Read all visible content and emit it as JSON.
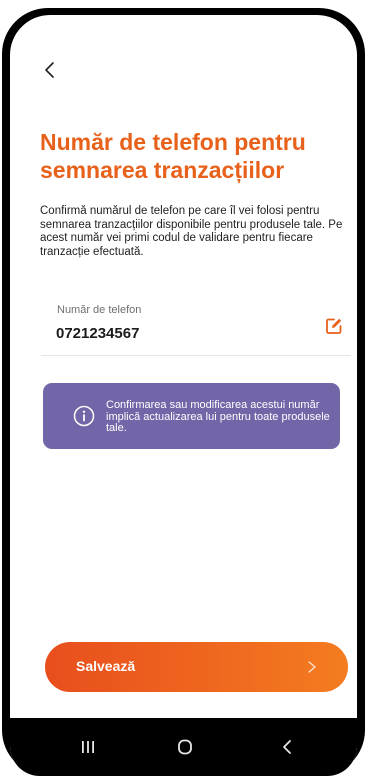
{
  "header": {
    "back_icon": "chevron-left-icon"
  },
  "page": {
    "title": "Număr de telefon pentru semnarea tranzacțiilor",
    "description": "Confirmă numărul de telefon pe care îl vei folosi pentru semnarea tranzacțiilor disponibile pentru produsele tale. Pe acest număr vei primi codul de validare pentru fiecare tranzacție efectuată."
  },
  "phone_field": {
    "label": "Număr de telefon",
    "value": "0721234567",
    "edit_icon": "edit-icon"
  },
  "info": {
    "icon": "info-icon",
    "text": "Confirmarea sau modificarea acestui număr implică actualizarea lui pentru toate produsele tale.",
    "background": "#7366A8"
  },
  "save_button": {
    "label": "Salvează",
    "arrow_icon": "chevron-right-icon"
  },
  "colors": {
    "accent": "#E8611A",
    "button_start": "#E84E1D",
    "button_end": "#F47C20",
    "info_bg": "#7366A8"
  },
  "nav": {
    "recents_icon": "recents-icon",
    "home_icon": "home-icon",
    "back_icon": "back-icon"
  }
}
